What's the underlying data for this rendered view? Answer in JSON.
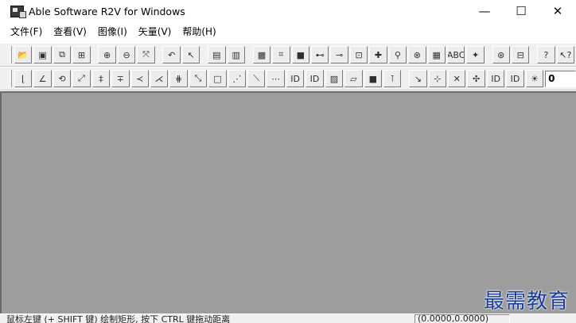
{
  "window": {
    "title": "Able Software R2V for Windows",
    "minimize": "—",
    "maximize": "☐",
    "close": "✕"
  },
  "menu": [
    {
      "label": "文件(F)"
    },
    {
      "label": "查看(V)"
    },
    {
      "label": "图像(I)"
    },
    {
      "label": "矢量(V)"
    },
    {
      "label": "帮助(H)"
    }
  ],
  "toolbar1": {
    "buttons": [
      {
        "glyph": "📂",
        "icon": "open-folder-icon"
      },
      {
        "glyph": "▣",
        "icon": "save-icon"
      },
      {
        "glyph": "⧉",
        "icon": "save-image-icon"
      },
      {
        "glyph": "⊞",
        "icon": "save-vector-icon"
      },
      {
        "glyph": "⊕",
        "icon": "zoom-in-icon"
      },
      {
        "glyph": "⊖",
        "icon": "zoom-out-icon"
      },
      {
        "glyph": "⤧",
        "icon": "zoom-fit-icon"
      },
      {
        "glyph": "↶",
        "icon": "undo-icon"
      },
      {
        "glyph": "↖",
        "icon": "select-pointer-icon"
      },
      {
        "glyph": "▤",
        "icon": "grid-icon"
      },
      {
        "glyph": "▥",
        "icon": "scan-icon"
      },
      {
        "glyph": "▩",
        "icon": "image-dither-icon"
      },
      {
        "glyph": "⌗",
        "icon": "frame-icon"
      },
      {
        "glyph": "■",
        "icon": "filled-square-icon"
      },
      {
        "glyph": "⊷",
        "icon": "node-line-icon"
      },
      {
        "glyph": "⊸",
        "icon": "line-end-icon"
      },
      {
        "glyph": "⊡",
        "icon": "label-box-icon"
      },
      {
        "glyph": "✚",
        "icon": "cross-point-icon"
      },
      {
        "glyph": "⚲",
        "icon": "pin-icon"
      },
      {
        "glyph": "⊗",
        "icon": "delete-node-icon"
      },
      {
        "glyph": "▦",
        "icon": "raster-icon"
      },
      {
        "glyph": "ABC",
        "icon": "ocr-text-icon"
      },
      {
        "glyph": "✦",
        "icon": "star-point-icon"
      },
      {
        "glyph": "⊛",
        "icon": "settings-icon"
      },
      {
        "glyph": "⊟",
        "icon": "property-icon"
      },
      {
        "glyph": "?",
        "icon": "help-icon"
      },
      {
        "glyph": "↖?",
        "icon": "context-help-icon"
      }
    ]
  },
  "toolbar2": {
    "buttons": [
      {
        "glyph": "⌊",
        "icon": "edit-line-icon"
      },
      {
        "glyph": "∠",
        "icon": "angle-icon"
      },
      {
        "glyph": "⟲",
        "icon": "rotate-icon"
      },
      {
        "glyph": "⤢",
        "icon": "diagonal-icon"
      },
      {
        "glyph": "‡",
        "icon": "split-icon"
      },
      {
        "glyph": "∓",
        "icon": "join-icon"
      },
      {
        "glyph": "≺",
        "icon": "break-icon"
      },
      {
        "glyph": "⋌",
        "icon": "trace-icon"
      },
      {
        "glyph": "⋕",
        "icon": "mesh-icon"
      },
      {
        "glyph": "⤡",
        "icon": "stretch-icon"
      },
      {
        "glyph": "□",
        "icon": "rectangle-icon"
      },
      {
        "glyph": "⋰",
        "icon": "chain-icon"
      },
      {
        "glyph": "⟍",
        "icon": "slash-icon"
      },
      {
        "glyph": "⋯",
        "icon": "dots-icon"
      },
      {
        "glyph": "ID",
        "icon": "id-label-icon"
      },
      {
        "glyph": "ID",
        "icon": "id-box-icon"
      },
      {
        "glyph": "▨",
        "icon": "hatch-icon"
      },
      {
        "glyph": "▱",
        "icon": "parallelogram-icon"
      },
      {
        "glyph": "■",
        "icon": "fill-block-icon"
      },
      {
        "glyph": "⊺",
        "icon": "tick-icon"
      },
      {
        "glyph": "↘",
        "icon": "move-node-icon"
      },
      {
        "glyph": "⊹",
        "icon": "add-point-icon"
      },
      {
        "glyph": "✕",
        "icon": "remove-point-icon"
      },
      {
        "glyph": "✣",
        "icon": "move-all-icon"
      },
      {
        "glyph": "ID",
        "icon": "id-edit-icon"
      },
      {
        "glyph": "ID",
        "icon": "id-small-icon"
      },
      {
        "glyph": "☀",
        "icon": "brightness-icon"
      }
    ],
    "field_value": "0"
  },
  "status": {
    "message": "鼠标左键 (+ SHIFT 键) 绘制矩形, 按下 CTRL 键拖动距离",
    "coords": "(0.0000,0.0000)"
  },
  "watermark": "最需教育",
  "colors": {
    "workspace": "#9d9d9d",
    "toolbar": "#f0f0f0",
    "watermark": "#1a3c9c"
  }
}
